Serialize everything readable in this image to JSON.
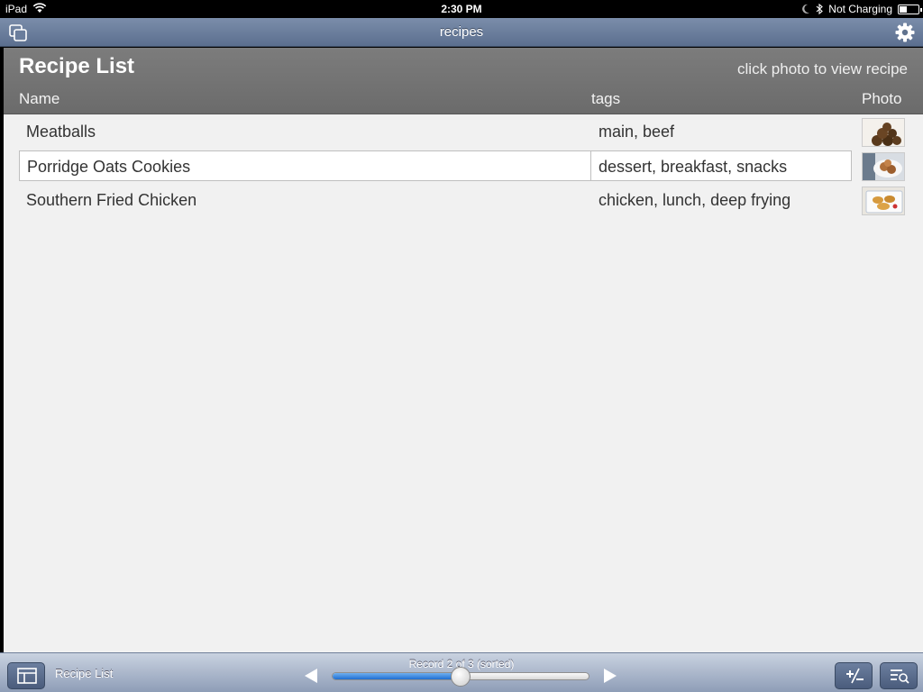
{
  "status_bar": {
    "device": "iPad",
    "time": "2:30 PM",
    "charging": "Not Charging",
    "battery_level": 0.4
  },
  "nav": {
    "title": "recipes"
  },
  "layout": {
    "title": "Recipe List",
    "hint": "click photo to view recipe",
    "columns": {
      "name": "Name",
      "tags": "tags",
      "photo": "Photo"
    }
  },
  "records": [
    {
      "name": "Meatballs",
      "tags": "main, beef",
      "photo": "meatballs-thumbnail",
      "selected": false
    },
    {
      "name": "Porridge Oats Cookies",
      "tags": "dessert, breakfast, snacks",
      "photo": "cookies-thumbnail",
      "selected": true
    },
    {
      "name": "Southern Fried Chicken",
      "tags": "chicken, lunch, deep frying",
      "photo": "fried-chicken-thumbnail",
      "selected": false
    }
  ],
  "toolbar": {
    "layout_label": "Recipe List",
    "record_label": "Record 2 of 3 (sorted)",
    "record_position": 0.5
  },
  "icons": {
    "windows": "windows-icon",
    "settings": "gear-icon",
    "layouts": "layouts-icon",
    "add_remove": "add-remove-icon",
    "find": "find-icon"
  }
}
